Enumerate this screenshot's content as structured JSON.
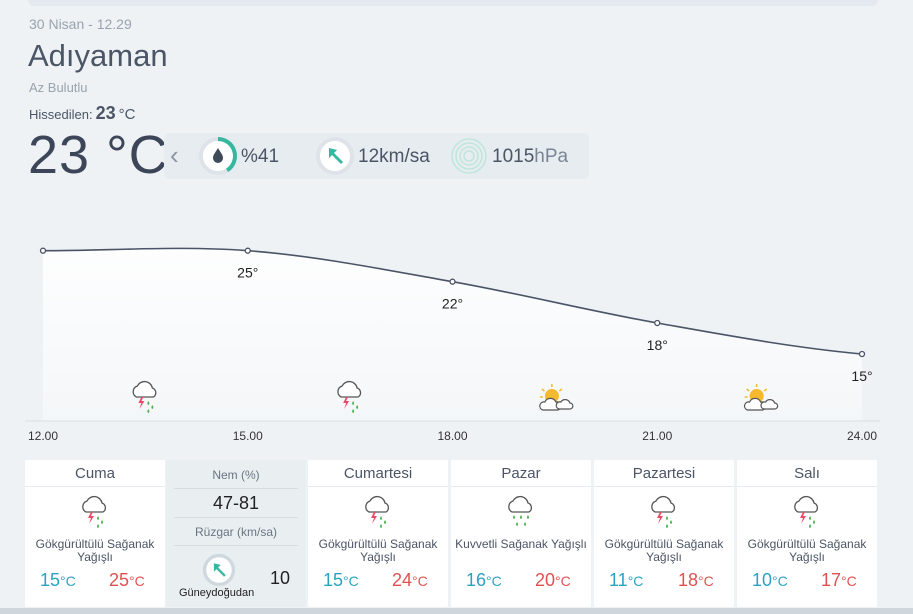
{
  "header": {
    "date": "30 Nisan - 12.29",
    "city": "Adıyaman",
    "condition": "Az Bulutlu",
    "feels_label": "Hissedilen:",
    "feels_value": "23",
    "feels_unit": "°C",
    "temperature": "23 °C"
  },
  "stats": {
    "humidity": "%41",
    "humidity_fraction": 0.41,
    "wind_value": "12",
    "wind_unit": "km/sa",
    "pressure_value": "1015",
    "pressure_unit": "hPa"
  },
  "chart_data": {
    "type": "line",
    "x": [
      "12.00",
      "15.00",
      "18.00",
      "21.00",
      "24.00"
    ],
    "values": [
      25,
      25,
      22,
      18,
      15
    ],
    "point_labels": [
      "",
      "25°",
      "22°",
      "18°",
      "15°"
    ],
    "icons": [
      "thunderstorm-rain-icon",
      "thunderstorm-rain-icon",
      "partly-cloudy-icon",
      "partly-cloudy-icon"
    ],
    "ylim": [
      12,
      27
    ]
  },
  "today_detail": {
    "humidity_label": "Nem (%)",
    "humidity_range": "47-81",
    "wind_label": "Rüzgar (km/sa)",
    "wind_direction": "Güneydoğudan",
    "wind_speed": "10"
  },
  "forecast": [
    {
      "day": "Cuma",
      "desc": "Gökgürültülü Sağanak Yağışlı",
      "low": "15",
      "high": "25",
      "icon": "thunderstorm-rain-icon"
    },
    {
      "day": "Cumartesi",
      "desc": "Gökgürültülü Sağanak Yağışlı",
      "low": "15",
      "high": "24",
      "icon": "thunderstorm-rain-icon"
    },
    {
      "day": "Pazar",
      "desc": "Kuvvetli Sağanak Yağışlı",
      "low": "16",
      "high": "20",
      "icon": "heavy-rain-icon"
    },
    {
      "day": "Pazartesi",
      "desc": "Gökgürültülü Sağanak Yağışlı",
      "low": "11",
      "high": "18",
      "icon": "thunderstorm-rain-icon"
    },
    {
      "day": "Salı",
      "desc": "Gökgürültülü Sağanak Yağışlı",
      "low": "10",
      "high": "17",
      "icon": "thunderstorm-rain-icon"
    }
  ],
  "units": {
    "c": "°C"
  },
  "colors": {
    "low": "#2aa3c2",
    "high": "#e05252",
    "accent": "#36b8a0",
    "rain": "#4caf50",
    "bolt": "#e84a6a"
  }
}
